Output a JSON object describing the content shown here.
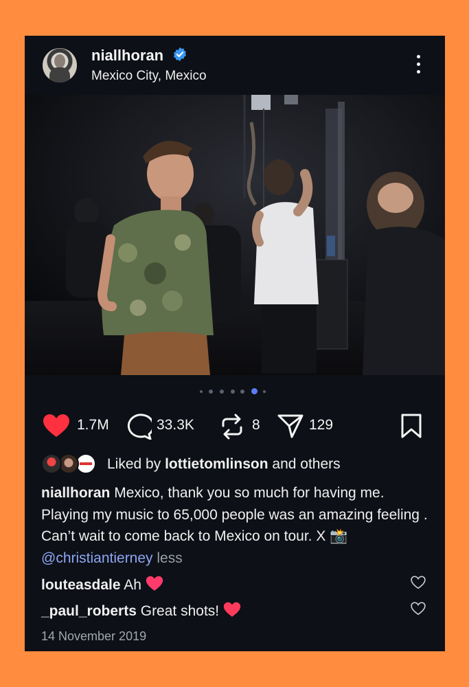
{
  "post": {
    "username": "niallhoran",
    "location": "Mexico City, Mexico",
    "verified": true,
    "carousel": {
      "count": 6,
      "active_index": 4
    },
    "actions": {
      "likes": "1.7M",
      "comments": "33.3K",
      "reposts": "8",
      "shares": "129"
    },
    "liked_by": {
      "prefix": "Liked by",
      "user": "lottietomlinson",
      "suffix": "and others"
    },
    "caption": {
      "author": "niallhoran",
      "text": "Mexico, thank you so much for having me. Playing my music to 65,000 people was an amazing feeling . Can’t wait to come back to Mexico on tour. X",
      "camera_emoji": "📸",
      "mention": "@christiantierney",
      "less_label": "less"
    },
    "comments": [
      {
        "user": "louteasdale",
        "text": "Ah"
      },
      {
        "user": "_paul_roberts",
        "text": "Great shots!"
      }
    ],
    "date": "14 November 2019"
  },
  "colors": {
    "background": "#FF8C3F",
    "card": "#0d1016",
    "like_red": "#ff3040",
    "verified_blue": "#3897f0",
    "mention_blue": "#8ea6f5",
    "active_dot": "#5b7cf7"
  }
}
